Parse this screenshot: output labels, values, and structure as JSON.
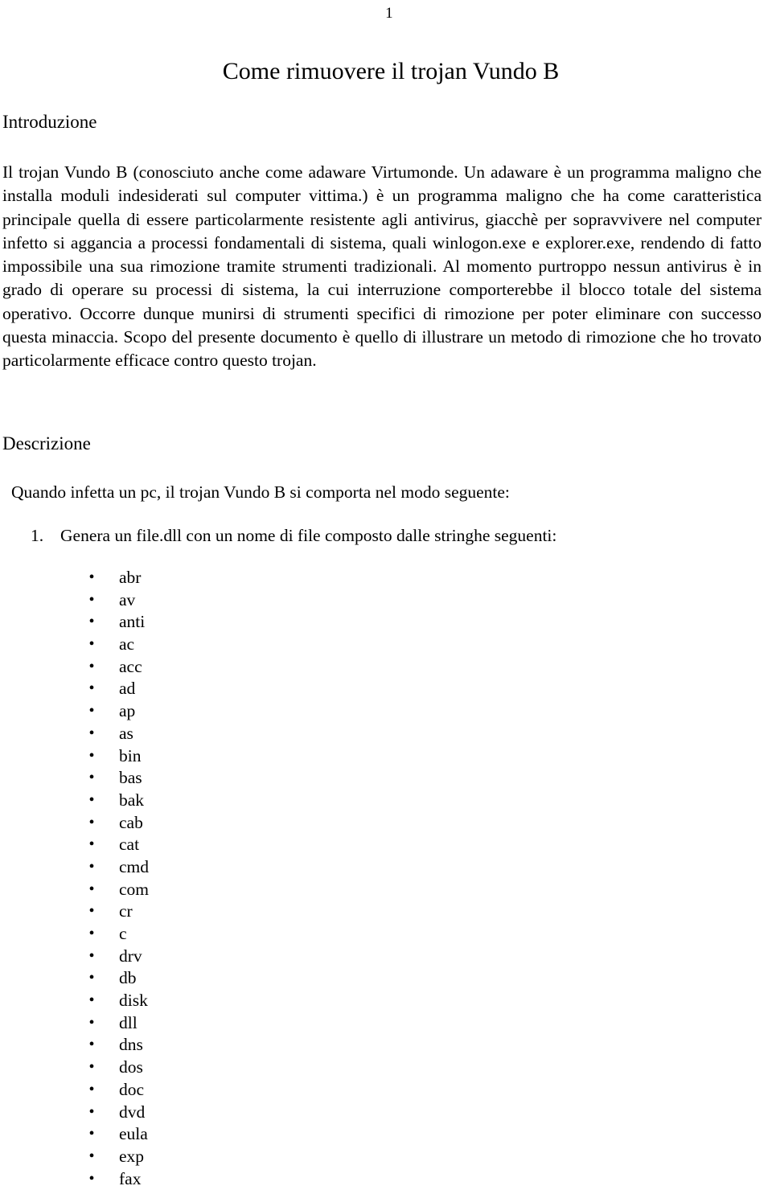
{
  "document": {
    "page_number": "1",
    "title": "Come rimuovere il trojan Vundo B",
    "sections": {
      "introduction": {
        "heading": "Introduzione",
        "paragraph": "Il trojan Vundo B (conosciuto anche come adaware  Virtumonde. Un adaware è un programma maligno che installa moduli indesiderati sul computer vittima.) è un programma maligno che ha come caratteristica principale quella di essere particolarmente resistente agli antivirus, giacchè per sopravvivere nel computer infetto si aggancia a processi fondamentali di sistema, quali winlogon.exe e explorer.exe, rendendo di fatto impossibile una sua rimozione tramite strumenti tradizionali. Al momento purtroppo nessun antivirus è in grado di operare su processi di sistema, la cui interruzione comporterebbe il blocco totale del sistema operativo. Occorre dunque munirsi di strumenti specifici di rimozione per poter eliminare con successo questa minaccia. Scopo del presente documento è quello di illustrare un metodo di rimozione che ho trovato particolarmente efficace contro questo trojan."
      },
      "description": {
        "heading": "Descrizione",
        "lead_line": "Quando infetta un pc, il trojan Vundo B  si comporta nel modo seguente:",
        "numbered_items": [
          {
            "marker": "1.",
            "text": "Genera un file.dll con un nome di file composto dalle stringhe seguenti:"
          }
        ],
        "bullet_marker": "•",
        "string_fragments": [
          "abr",
          "av",
          "anti",
          "ac",
          "acc",
          "ad",
          "ap",
          "as",
          "bin",
          "bas",
          "bak",
          "cab",
          "cat",
          "cmd",
          "com",
          "cr",
          "c",
          "drv",
          "db",
          "disk",
          "dll",
          "dns",
          "dos",
          "doc",
          "dvd",
          "eula",
          "exp",
          "fax"
        ]
      }
    }
  },
  "colors": {
    "page_background": "#ffffff",
    "text": "#000000"
  }
}
